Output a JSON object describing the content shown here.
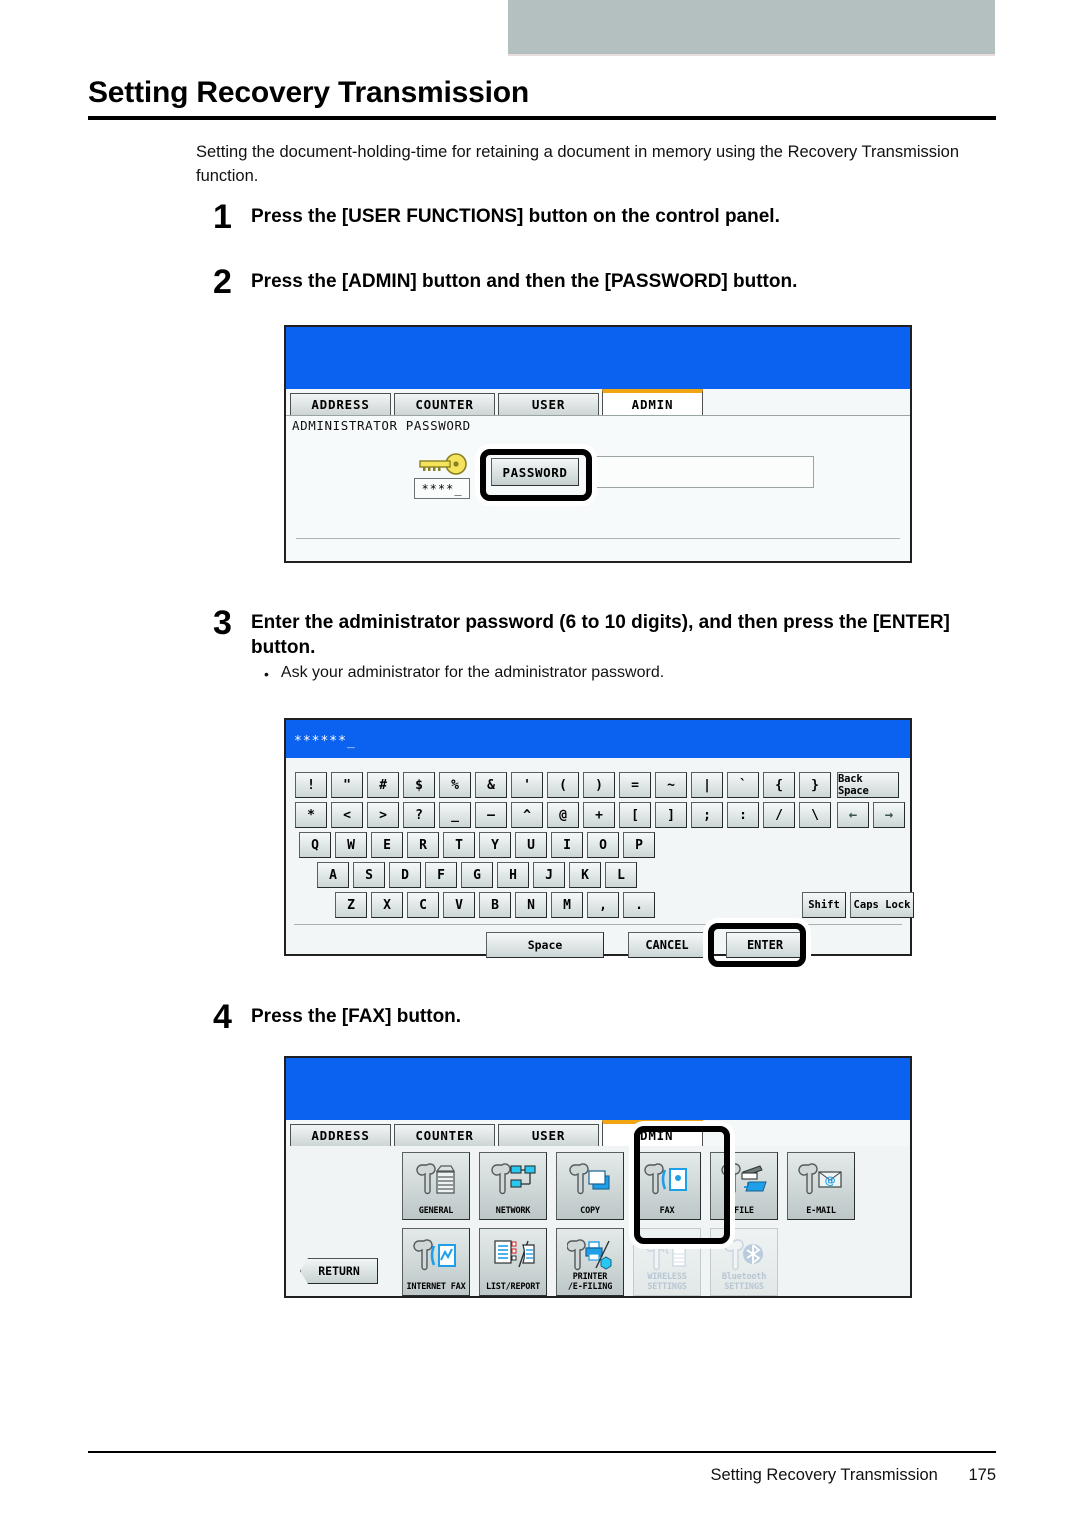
{
  "page": {
    "title": "Setting Recovery Transmission",
    "intro": "Setting the document-holding-time for retaining a document in memory using the Recovery Transmission function.",
    "footer_title": "Setting Recovery Transmission",
    "footer_page": "175"
  },
  "steps": [
    {
      "num": "1",
      "text": "Press the [USER FUNCTIONS] button on the control panel."
    },
    {
      "num": "2",
      "text": "Press the [ADMIN] button and then the [PASSWORD] button."
    },
    {
      "num": "3",
      "text": "Enter the administrator password (6 to 10 digits), and then press the [ENTER] button.",
      "bullet": "Ask your administrator for the administrator password."
    },
    {
      "num": "4",
      "text": "Press the [FAX] button."
    }
  ],
  "screenshot_password": {
    "tabs": [
      {
        "label": "ADDRESS",
        "active": false
      },
      {
        "label": "COUNTER",
        "active": false
      },
      {
        "label": "USER",
        "active": false
      },
      {
        "label": "ADMIN",
        "active": true
      }
    ],
    "caption": "ADMINISTRATOR PASSWORD",
    "key_icon": "key-icon",
    "masked_sample": "****_",
    "password_button": "PASSWORD",
    "field_value": ""
  },
  "screenshot_keyboard": {
    "entry_display": "******_",
    "rows": [
      [
        "!",
        "\"",
        "#",
        "$",
        "%",
        "&",
        "'",
        "(",
        ")",
        "=",
        "~",
        "|",
        "`",
        "{",
        "}"
      ],
      [
        "*",
        "<",
        ">",
        "?",
        "_",
        "—",
        "^",
        "@",
        "+",
        "[",
        "]",
        ";",
        ":",
        "/",
        "\\"
      ],
      [
        "Q",
        "W",
        "E",
        "R",
        "T",
        "Y",
        "U",
        "I",
        "O",
        "P"
      ],
      [
        "A",
        "S",
        "D",
        "F",
        "G",
        "H",
        "J",
        "K",
        "L"
      ],
      [
        "Z",
        "X",
        "C",
        "V",
        "B",
        "N",
        "M",
        ",",
        "."
      ]
    ],
    "back_space": "Back Space",
    "arrow_left": "←",
    "arrow_right": "→",
    "shift": "Shift",
    "caps_lock": "Caps Lock",
    "space": "Space",
    "cancel": "CANCEL",
    "enter": "ENTER"
  },
  "screenshot_admin_menu": {
    "tabs": [
      {
        "label": "ADDRESS",
        "active": false
      },
      {
        "label": "COUNTER",
        "active": false
      },
      {
        "label": "USER",
        "active": false
      },
      {
        "label": "ADMIN",
        "active": true
      }
    ],
    "return_button": "RETURN",
    "row1": [
      {
        "label": "GENERAL",
        "icon": "wrench-copier-icon",
        "disabled": false,
        "highlighted": false
      },
      {
        "label": "NETWORK",
        "icon": "wrench-network-icon",
        "disabled": false,
        "highlighted": false
      },
      {
        "label": "COPY",
        "icon": "wrench-copy-icon",
        "disabled": false,
        "highlighted": false
      },
      {
        "label": "FAX",
        "icon": "wrench-fax-icon",
        "disabled": false,
        "highlighted": true
      },
      {
        "label": "FILE",
        "icon": "wrench-file-icon",
        "disabled": false,
        "highlighted": false
      },
      {
        "label": "E-MAIL",
        "icon": "wrench-email-icon",
        "disabled": false,
        "highlighted": false
      }
    ],
    "row2": [
      {
        "label": "INTERNET FAX",
        "icon": "wrench-internet-fax-icon",
        "disabled": false
      },
      {
        "label": "LIST/REPORT",
        "icon": "wrench-list-report-icon",
        "disabled": false
      },
      {
        "label": "PRINTER\n/E-FILING",
        "icon": "wrench-printer-icon",
        "disabled": false
      },
      {
        "label": "WIRELESS\nSETTINGS",
        "icon": "wrench-wireless-icon",
        "disabled": true
      },
      {
        "label": "Bluetooth\nSETTINGS",
        "icon": "wrench-bluetooth-icon",
        "disabled": true
      }
    ]
  },
  "colors": {
    "lcd_blue": "#0b61f0",
    "tab_active_accent": "#f2a513",
    "icon_cyan": "#29a8e0",
    "top_band": "#b4c0c0"
  }
}
